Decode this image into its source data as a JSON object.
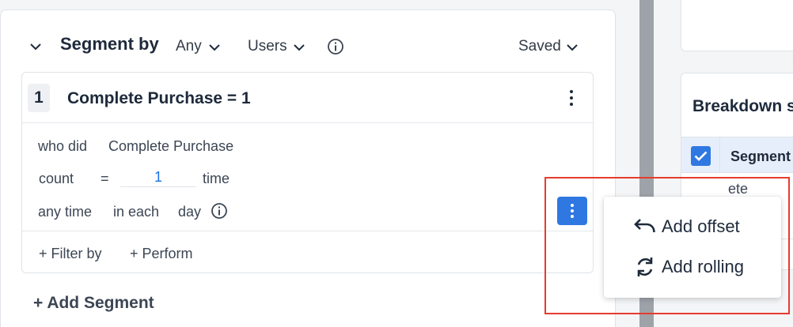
{
  "segment": {
    "title": "Segment by",
    "any_dropdown": "Any",
    "users_dropdown": "Users",
    "saved_dropdown": "Saved"
  },
  "event": {
    "step_number": "1",
    "title": "Complete Purchase = 1",
    "who_did_label": "who did",
    "event_name": "Complete Purchase",
    "count_label": "count",
    "operator": "=",
    "count_value": "1",
    "time_unit": "time",
    "time_range": "any time",
    "in_each_label": "in each",
    "interval": "day",
    "filter_by": "+ Filter by",
    "perform": "+ Perform"
  },
  "add_segment_label": "+ Add Segment",
  "context_menu": {
    "items": [
      {
        "label": "Add offset",
        "icon": "undo-arrow-icon"
      },
      {
        "label": "Add rolling",
        "icon": "rotate-arrows-icon"
      }
    ]
  },
  "breakdown": {
    "title": "Breakdown s",
    "column_header": "Segment",
    "cell_partial": "ete"
  },
  "colors": {
    "accent": "#2f78e2",
    "highlight": "#e53c2e",
    "count_value": "#1a73e8"
  }
}
